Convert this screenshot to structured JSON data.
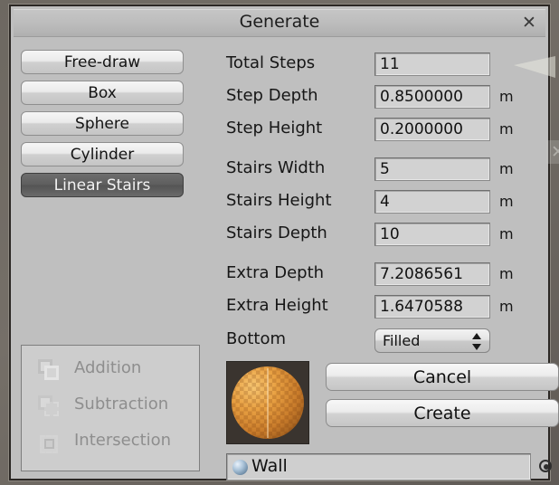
{
  "window": {
    "title": "Generate",
    "close_icon": "close-icon",
    "close_glyph": "✕"
  },
  "tools": [
    {
      "label": "Free-draw",
      "selected": false
    },
    {
      "label": "Box",
      "selected": false
    },
    {
      "label": "Sphere",
      "selected": false
    },
    {
      "label": "Cylinder",
      "selected": false
    },
    {
      "label": "Linear Stairs",
      "selected": true
    }
  ],
  "fields": [
    {
      "label": "Total Steps",
      "value": "11",
      "unit": ""
    },
    {
      "label": "Step Depth",
      "value": "0.8500000",
      "unit": "m"
    },
    {
      "label": "Step Height",
      "value": "0.2000000",
      "unit": "m"
    },
    {
      "label": "Stairs Width",
      "value": "5",
      "unit": "m"
    },
    {
      "label": "Stairs Height",
      "value": "4",
      "unit": "m"
    },
    {
      "label": "Stairs Depth",
      "value": "10",
      "unit": "m"
    },
    {
      "label": "Extra Depth",
      "value": "7.2086561",
      "unit": "m"
    },
    {
      "label": "Extra Height",
      "value": "1.6470588",
      "unit": "m"
    }
  ],
  "bottom": {
    "label": "Bottom",
    "selected": "Filled",
    "options": [
      "Filled"
    ]
  },
  "csg": {
    "items": [
      {
        "label": "Addition",
        "icon": "csg-addition-icon",
        "enabled": false
      },
      {
        "label": "Subtraction",
        "icon": "csg-subtraction-icon",
        "enabled": false
      },
      {
        "label": "Intersection",
        "icon": "csg-intersection-icon",
        "enabled": false
      }
    ]
  },
  "actions": {
    "cancel_label": "Cancel",
    "create_label": "Create"
  },
  "material": {
    "name": "Wall",
    "preview_icon": "material-preview-sphere",
    "picker_icon": "target-picker-icon"
  },
  "colors": {
    "panel": "#bfbfbf",
    "field": "#d2d2d2",
    "selected_tool": "#5e5e5e",
    "text": "#161616",
    "disabled_text": "#8e8e8e",
    "material_orange": "#e8a042"
  }
}
